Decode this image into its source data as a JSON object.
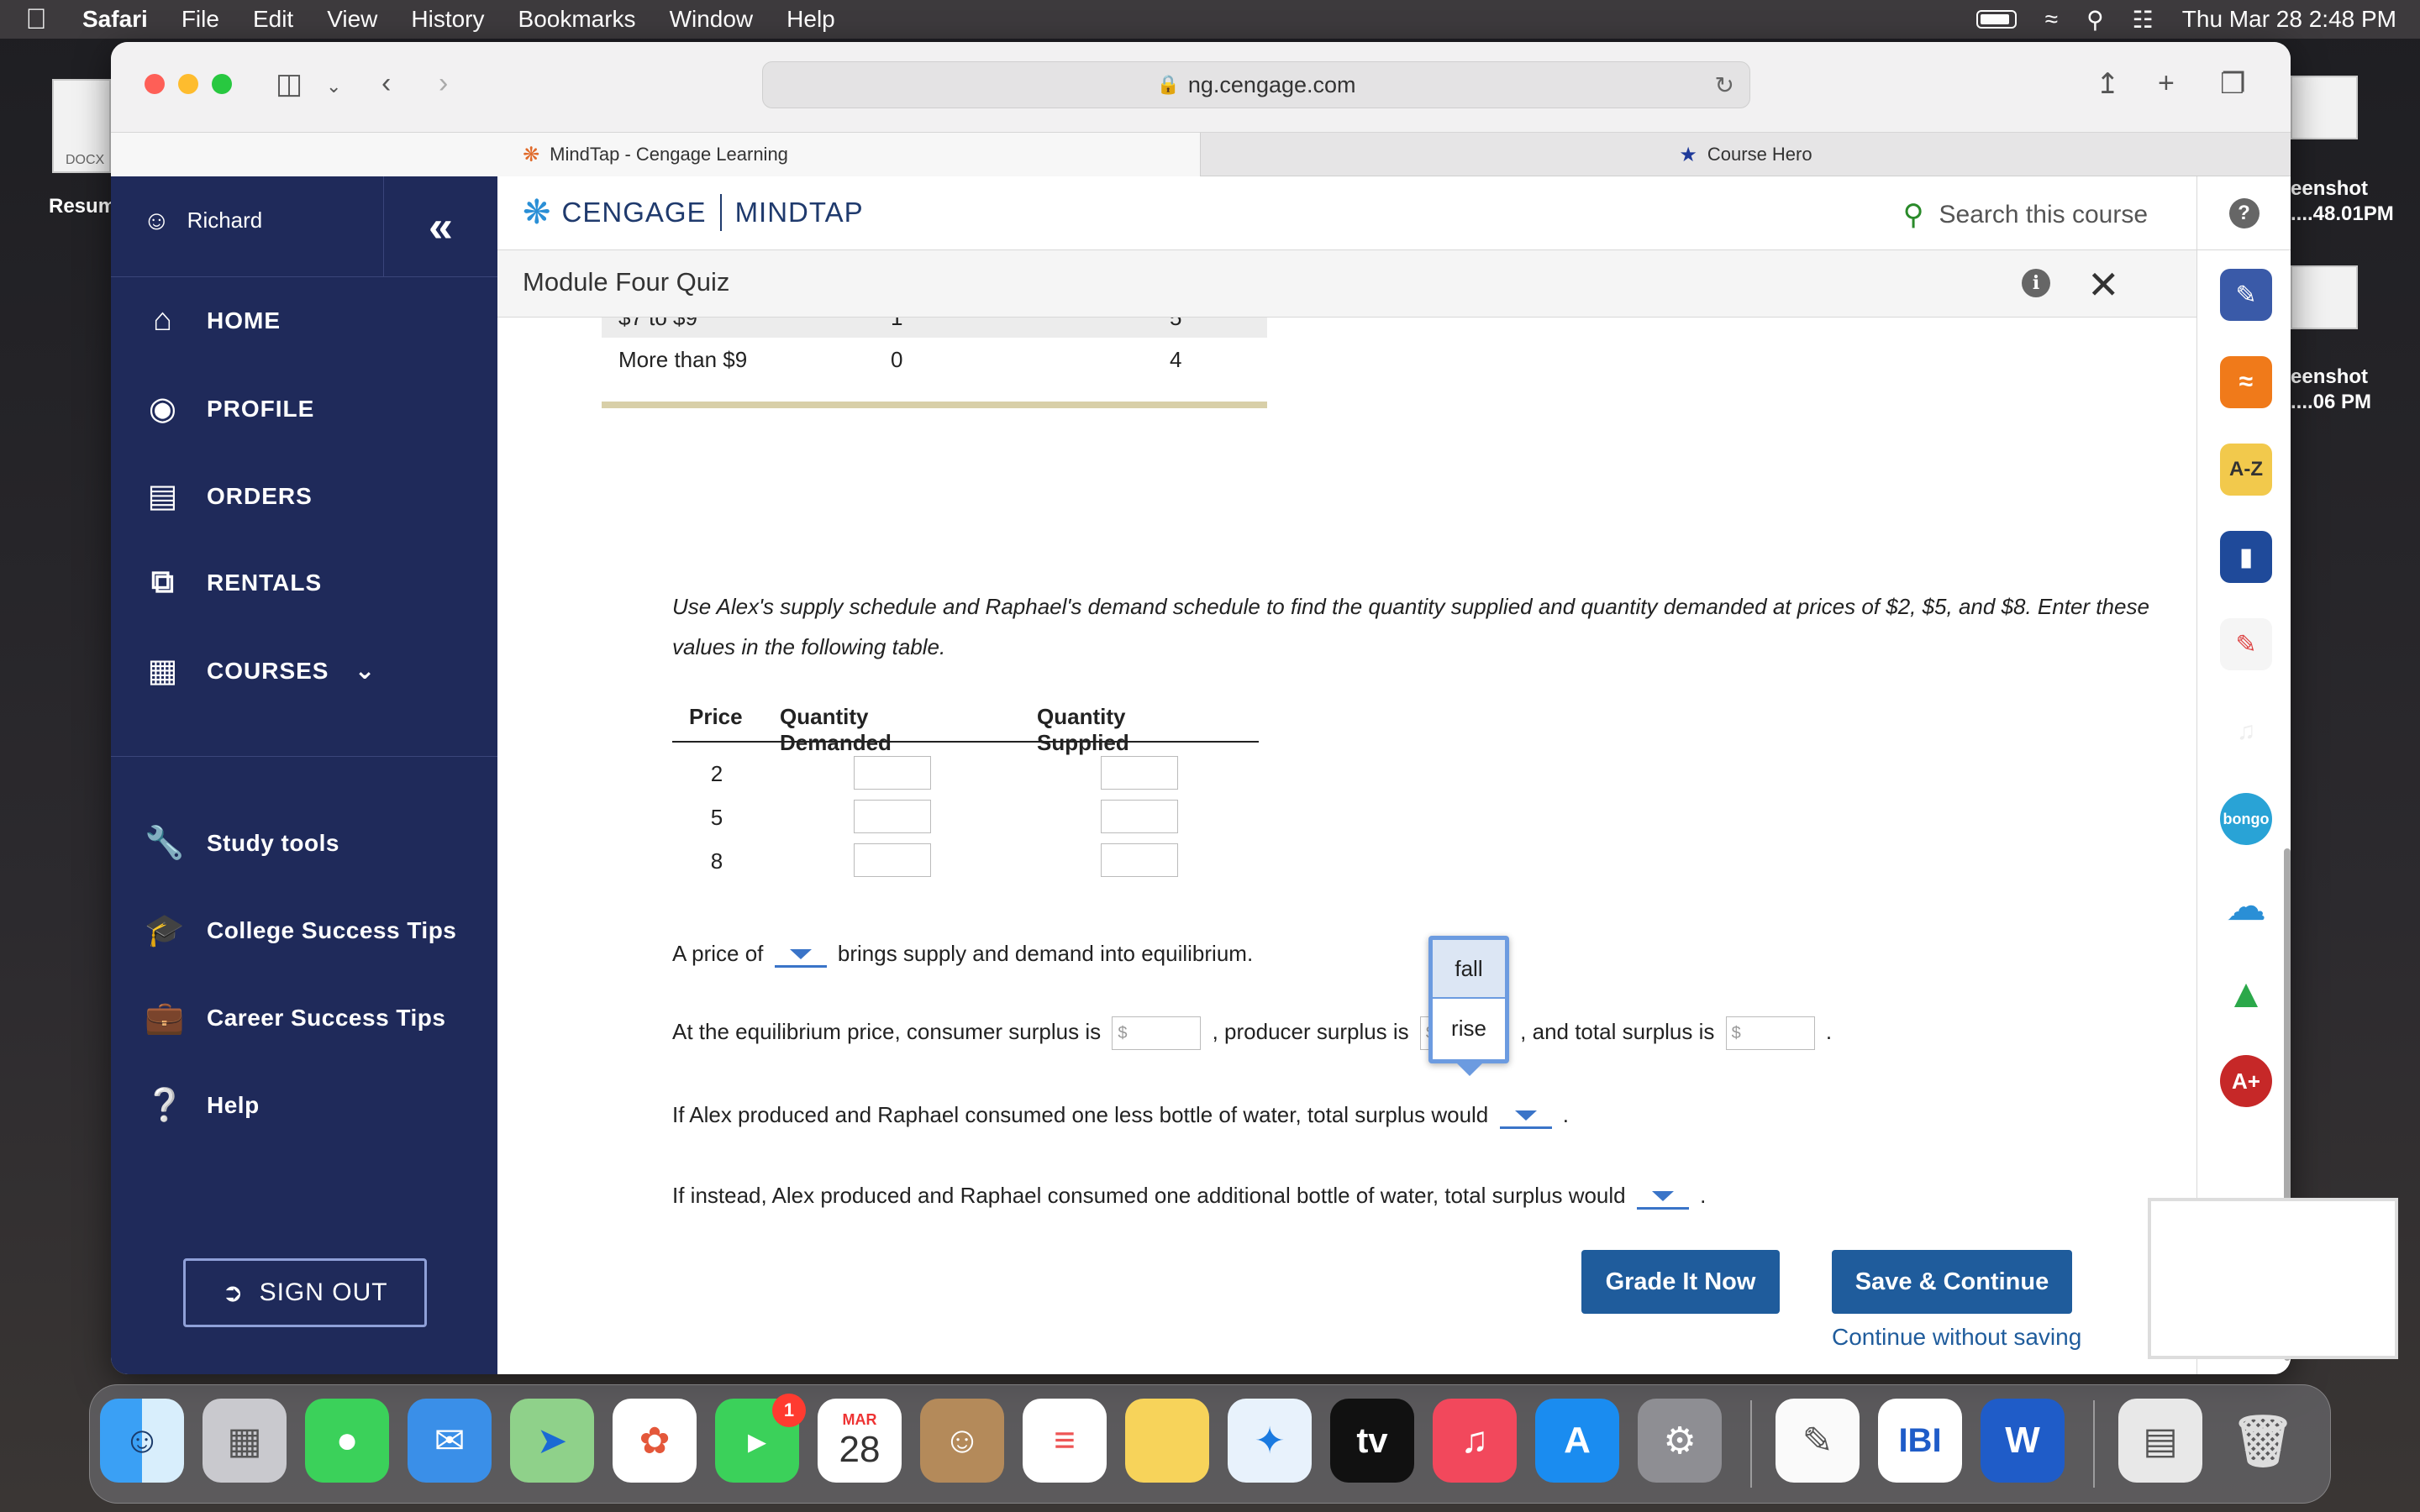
{
  "menubar": {
    "items": [
      "Safari",
      "File",
      "Edit",
      "View",
      "History",
      "Bookmarks",
      "Window",
      "Help"
    ],
    "datetime": "Thu Mar 28  2:48 PM"
  },
  "desktop": {
    "left_file_label": "Resum",
    "left_file_type": "DOCX",
    "right_file_1_line1": "eenshot",
    "right_file_1_line2": "....48.01PM",
    "right_file_2_line1": "eenshot",
    "right_file_2_line2": "....06 PM"
  },
  "browser": {
    "url": "ng.cengage.com",
    "tabs": [
      {
        "label": "MindTap - Cengage Learning",
        "active": true
      },
      {
        "label": "Course Hero",
        "active": false
      }
    ]
  },
  "sidebar": {
    "user": "Richard",
    "collapse_glyph": "«",
    "nav": [
      {
        "label": "HOME",
        "icon": "home-icon"
      },
      {
        "label": "PROFILE",
        "icon": "profile-icon"
      },
      {
        "label": "ORDERS",
        "icon": "orders-icon"
      },
      {
        "label": "RENTALS",
        "icon": "rentals-icon"
      },
      {
        "label": "COURSES",
        "icon": "courses-icon"
      }
    ],
    "sub_nav": [
      {
        "label": "Study tools",
        "icon": "wrench-icon"
      },
      {
        "label": "College Success Tips",
        "icon": "graduation-cap-icon"
      },
      {
        "label": "Career Success Tips",
        "icon": "briefcase-icon"
      },
      {
        "label": "Help",
        "icon": "help-icon"
      }
    ],
    "sign_out": "SIGN OUT"
  },
  "header": {
    "brand_left": "CENGAGE",
    "brand_right": "MINDTAP",
    "search_placeholder": "Search this course",
    "module_title": "Module Four Quiz"
  },
  "old_table": {
    "rows": [
      {
        "range": "$7 to $9",
        "a": "1",
        "b": "5"
      },
      {
        "range": "More than $9",
        "a": "0",
        "b": "4"
      }
    ]
  },
  "question": {
    "instructions": "Use Alex's supply schedule and Raphael's demand schedule to find the quantity supplied and quantity demanded at prices of $2, $5, and $8. Enter these values in the following table.",
    "table_headers": [
      "Price",
      "Quantity Demanded",
      "Quantity Supplied"
    ],
    "prices": [
      "2",
      "5",
      "8"
    ],
    "equilibrium_pre": "A price of",
    "equilibrium_post": "brings supply and demand into equilibrium.",
    "surplus_1": "At the equilibrium price, consumer surplus is",
    "surplus_2": ", producer surplus is",
    "surplus_3": ", and total surplus is",
    "dollar": "$",
    "period": ".",
    "less_sentence": "If Alex produced and Raphael consumed one less bottle of water, total surplus would",
    "more_sentence": "If instead, Alex produced and Raphael consumed one additional bottle of water, total surplus would",
    "dropdown_options": [
      "fall",
      "rise"
    ]
  },
  "actions": {
    "grade": "Grade It Now",
    "save": "Save & Continue",
    "continue": "Continue without saving"
  },
  "dock": {
    "calendar_month": "MAR",
    "calendar_day": "28",
    "facetime_badge": "1",
    "tv_label": "tv"
  }
}
